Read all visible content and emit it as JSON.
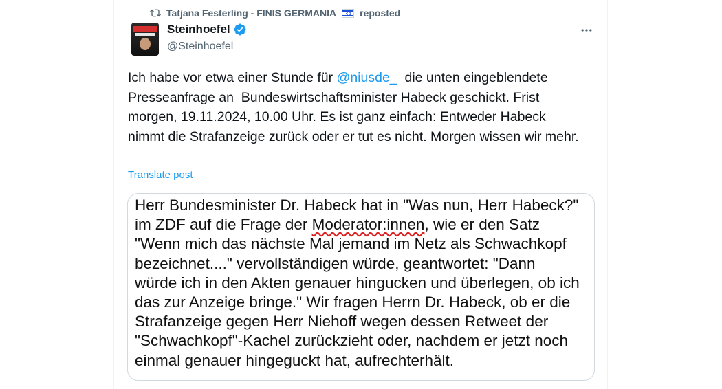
{
  "repost": {
    "user": "Tatjana Festerling - FINIS GERMANIA",
    "flag_icon": "israel-flag",
    "label": "reposted"
  },
  "author": {
    "name": "Steinhoefel",
    "handle": "@Steinhoefel",
    "verified": true
  },
  "post": {
    "text_before": "Ich habe vor etwa einer Stunde für ",
    "mention": "@niusde_",
    "text_after": "  die unten eingeblendete Presseanfrage an  Bundeswirtschaftsminister Habeck geschickt. Frist morgen, 19.11.2024, 10.00 Uhr. Es ist ganz einfach: Entweder Habeck nimmt die Strafanzeige zurück oder er tut es nicht. Morgen wissen wir mehr.",
    "translate": "Translate post"
  },
  "image_text": {
    "lines": [
      "Herr Bundesminister Dr. Habeck hat in \"Was nun, Herr Habeck?\"",
      "im ZDF auf die Frage der ",
      "\"Wenn mich das nächste Mal jemand im Netz als Schwachkopf",
      "bezeichnet....\" vervollständigen würde, geantwortet: \"Dann",
      "würde ich in den Akten genauer hingucken und überlegen, ob ich",
      "das zur Anzeige bringe.\" Wir fragen Herrn Dr. Habeck, ob er die",
      "Strafanzeige gegen Herr Niehoff wegen dessen Retweet der",
      "\"Schwachkopf\"-Kachel zurückzieht oder, nachdem er jetzt noch",
      "einmal genauer hingeguckt hat, aufrechterhält."
    ],
    "line2_underlined": "Moderator:innen",
    "line2_rest": ", wie er den Satz"
  },
  "colors": {
    "accent": "#1d9bf0",
    "muted": "#536471",
    "border": "#cfd9de"
  }
}
